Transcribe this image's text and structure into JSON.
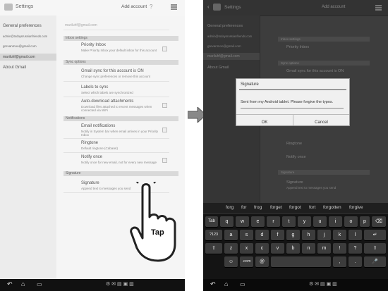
{
  "left": {
    "title": "Settings",
    "add_account": "Add account",
    "sidebar": [
      {
        "label": "General preferences"
      },
      {
        "label": "admin@todaysrussianfriends.com"
      },
      {
        "label": "grevanmoo@gmail.com"
      },
      {
        "label": "mariluhf@gmail.com"
      },
      {
        "label": "About Gmail"
      }
    ],
    "account_header": "mariluhf@gmail.com",
    "sections": {
      "inbox": "Inbox settings",
      "sync": "Sync options",
      "notifications": "Notifications",
      "signature": "Signature"
    },
    "items": {
      "priority_title": "Priority Inbox",
      "priority_sub": "Make Priority Inbox your default inbox for this account",
      "gsync_title": "Gmail sync for this account is ON",
      "gsync_sub": "Change sync preferences or remove this account",
      "labels_title": "Labels to sync",
      "labels_sub": "Select which labels are synchronized",
      "attach_title": "Auto-download attachments",
      "attach_sub": "Download files attached to recent messages when connected via WiFi",
      "emailnot_title": "Email notifications",
      "emailnot_sub": "Notify in System bar when email arrives in your Priority Inbox",
      "ringtone_title": "Ringtone",
      "ringtone_sub": "Default ringtone (Cabaret)",
      "notifyonce_title": "Notify once",
      "notifyonce_sub": "Notify once for new email, not for every new message",
      "sig_title": "Signature",
      "sig_sub": "Append text to messages you send"
    },
    "tap": "Tap"
  },
  "right": {
    "title": "Settings",
    "add_account": "Add account",
    "sidebar": [
      "General preferences",
      "admin@todaysrussianfriends.com",
      "grevanmoo@gmail.com",
      "mariluhf@gmail.com",
      "About Gmail"
    ],
    "bg": {
      "inbox": "Inbox settings",
      "priority": "Priority Inbox",
      "sync": "Sync options",
      "gsync": "Gmail sync for this account is ON",
      "ringtone": "Ringtone",
      "notifyonce": "Notify once",
      "signature": "Signature",
      "sig_title": "Signature",
      "sig_sub": "Append text to messages you send"
    },
    "dialog": {
      "title": "Signature",
      "text": "Sent from my Android tablet. Please forgive the typos.",
      "ok": "OK",
      "cancel": "Cancel"
    },
    "suggestions": [
      "forg",
      "for",
      "frog",
      "forget",
      "forgot",
      "fort",
      "forgotten",
      "forgive"
    ],
    "rows": [
      [
        "q",
        "w",
        "e",
        "r",
        "t",
        "y",
        "u",
        "i",
        "o",
        "p"
      ],
      [
        "a",
        "s",
        "d",
        "f",
        "g",
        "h",
        "j",
        "k",
        "l"
      ],
      [
        "z",
        "x",
        "c",
        "v",
        "b",
        "n",
        "m",
        "!",
        "?"
      ]
    ],
    "keys": {
      "tab": "Tab",
      "num": "?123",
      "sym": "?123",
      "dotcom": ".com",
      "comma": ",",
      "period": "."
    }
  },
  "colors": {
    "accent": "#3a3a3a",
    "dialog_line": "#4a4a4a"
  }
}
